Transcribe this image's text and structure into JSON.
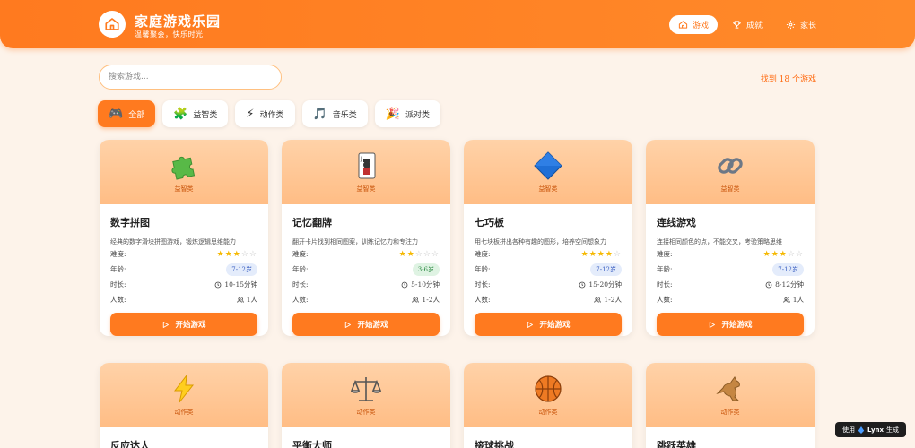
{
  "header": {
    "title": "家庭游戏乐园",
    "subtitle": "温馨聚会，快乐时光",
    "nav": [
      {
        "label": "游戏",
        "icon": "home-icon",
        "active": true
      },
      {
        "label": "成就",
        "icon": "trophy-icon",
        "active": false
      },
      {
        "label": "家长",
        "icon": "gear-icon",
        "active": false
      }
    ]
  },
  "search": {
    "placeholder": "搜索游戏..."
  },
  "results": {
    "text": "找到 18 个游戏"
  },
  "filters": [
    {
      "label": "全部",
      "emoji": "🎮",
      "active": true
    },
    {
      "label": "益智类",
      "emoji": "🧩",
      "active": false
    },
    {
      "label": "动作类",
      "emoji": "⚡",
      "active": false
    },
    {
      "label": "音乐类",
      "emoji": "🎵",
      "active": false
    },
    {
      "label": "派对类",
      "emoji": "🎉",
      "active": false
    }
  ],
  "labels": {
    "difficulty": "难度:",
    "age": "年龄:",
    "duration": "时长:",
    "players": "人数:",
    "play": "开始游戏"
  },
  "cards": [
    {
      "title": "数字拼图",
      "category": "益智类",
      "icon": "puzzle-icon",
      "desc": "经典的数字滑块拼图游戏，锻炼逻辑思维能力",
      "difficulty": 3,
      "age": "7-12岁",
      "age_color": "blue",
      "duration": "10-15分钟",
      "players": "1人"
    },
    {
      "title": "记忆翻牌",
      "category": "益智类",
      "icon": "playing-card-icon",
      "desc": "翻开卡片找到相同图案，训练记忆力和专注力",
      "difficulty": 2,
      "age": "3-6岁",
      "age_color": "green",
      "duration": "5-10分钟",
      "players": "1-2人"
    },
    {
      "title": "七巧板",
      "category": "益智类",
      "icon": "diamond-icon",
      "desc": "用七块板拼出各种有趣的图形，培养空间想象力",
      "difficulty": 4,
      "age": "7-12岁",
      "age_color": "blue",
      "duration": "15-20分钟",
      "players": "1-2人"
    },
    {
      "title": "连线游戏",
      "category": "益智类",
      "icon": "chain-link-icon",
      "desc": "连接相同颜色的点，不能交叉，考验策略思维",
      "difficulty": 3,
      "age": "7-12岁",
      "age_color": "blue",
      "duration": "8-12分钟",
      "players": "1人"
    },
    {
      "title": "反应达人",
      "category": "动作类",
      "icon": "lightning-icon"
    },
    {
      "title": "平衡大师",
      "category": "动作类",
      "icon": "balance-scale-icon"
    },
    {
      "title": "接球挑战",
      "category": "动作类",
      "icon": "basketball-icon"
    },
    {
      "title": "跳跃英雄",
      "category": "动作类",
      "icon": "kangaroo-icon"
    }
  ],
  "badge": {
    "prefix": "使用",
    "brand": "Lynx",
    "suffix": "生成"
  }
}
